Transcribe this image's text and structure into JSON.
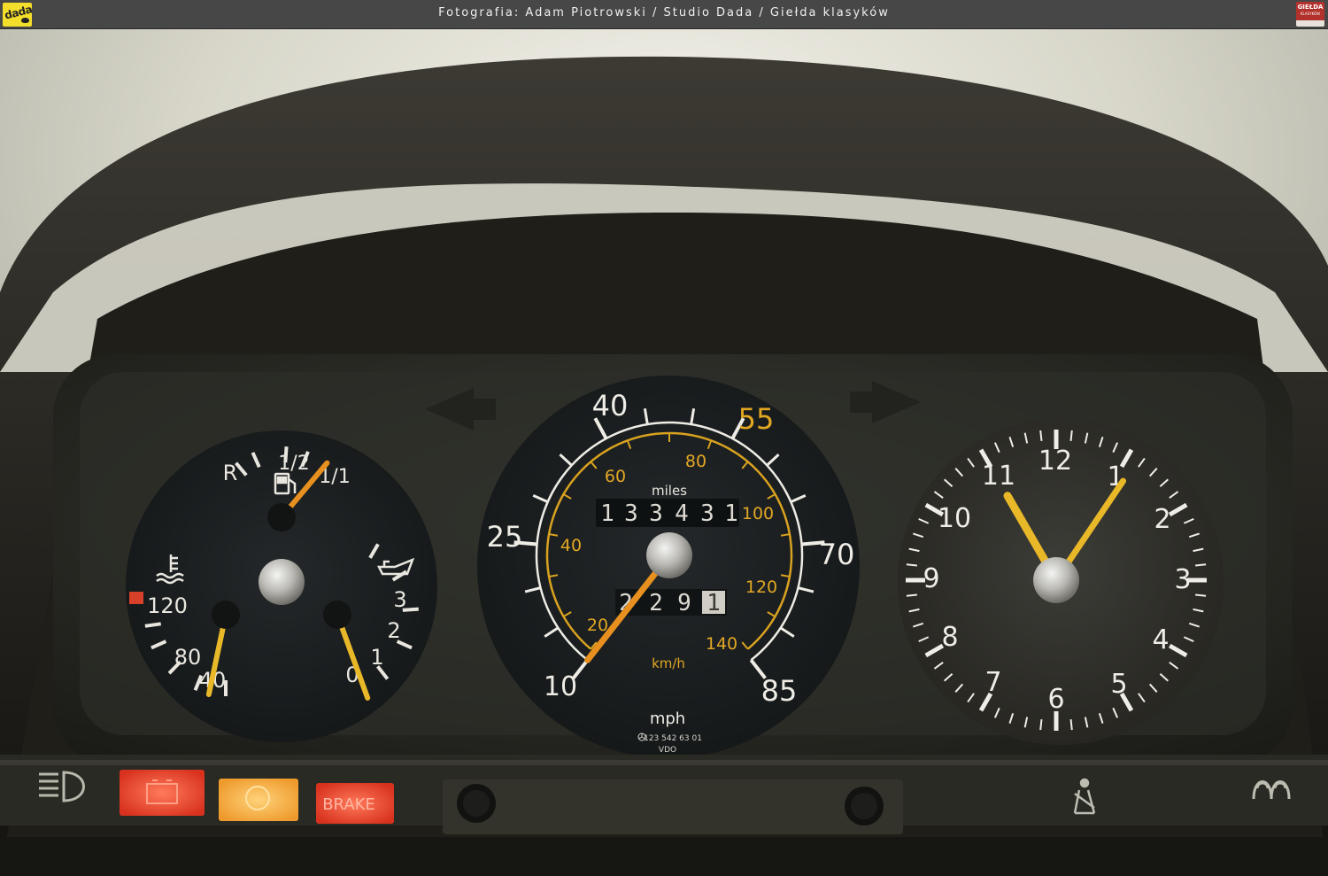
{
  "header": {
    "caption": "Fotografia: Adam Piotrowski / Studio Dada / Giełda klasyków",
    "logo_left_text": "dada",
    "logo_right_text_1": "GIEŁDA",
    "logo_right_text_2": "KLASYKÓW"
  },
  "left_gauge": {
    "fuel_labels": [
      "R",
      "1/2",
      "1/1"
    ],
    "temp_labels": [
      "120",
      "80",
      "40"
    ],
    "oil_labels": [
      "3",
      "2",
      "1",
      "0"
    ]
  },
  "speedometer": {
    "mph_labels": [
      "10",
      "25",
      "40",
      "55",
      "70",
      "85"
    ],
    "kmh_labels": [
      "20",
      "40",
      "60",
      "80",
      "100",
      "120",
      "140"
    ],
    "miles_label": "miles",
    "odometer_digits": [
      "1",
      "3",
      "3",
      "4",
      "3",
      "1"
    ],
    "trip_digits": [
      "2",
      "2",
      "9",
      "1"
    ],
    "kmh_unit": "km/h",
    "mph_unit": "mph",
    "part_number": "123 542 63 01",
    "brand": "VDO"
  },
  "clock": {
    "numbers": [
      "12",
      "1",
      "2",
      "3",
      "4",
      "5",
      "6",
      "7",
      "8",
      "9",
      "10",
      "11"
    ]
  },
  "warning_lights": {
    "brake_label": "BRAKE"
  },
  "colors": {
    "needle_orange": "#e8901f",
    "needle_yellow": "#e9b829",
    "kmh_yellow": "#d9a220",
    "warning_red": "#e8432f",
    "warning_amber": "#f2a838"
  }
}
